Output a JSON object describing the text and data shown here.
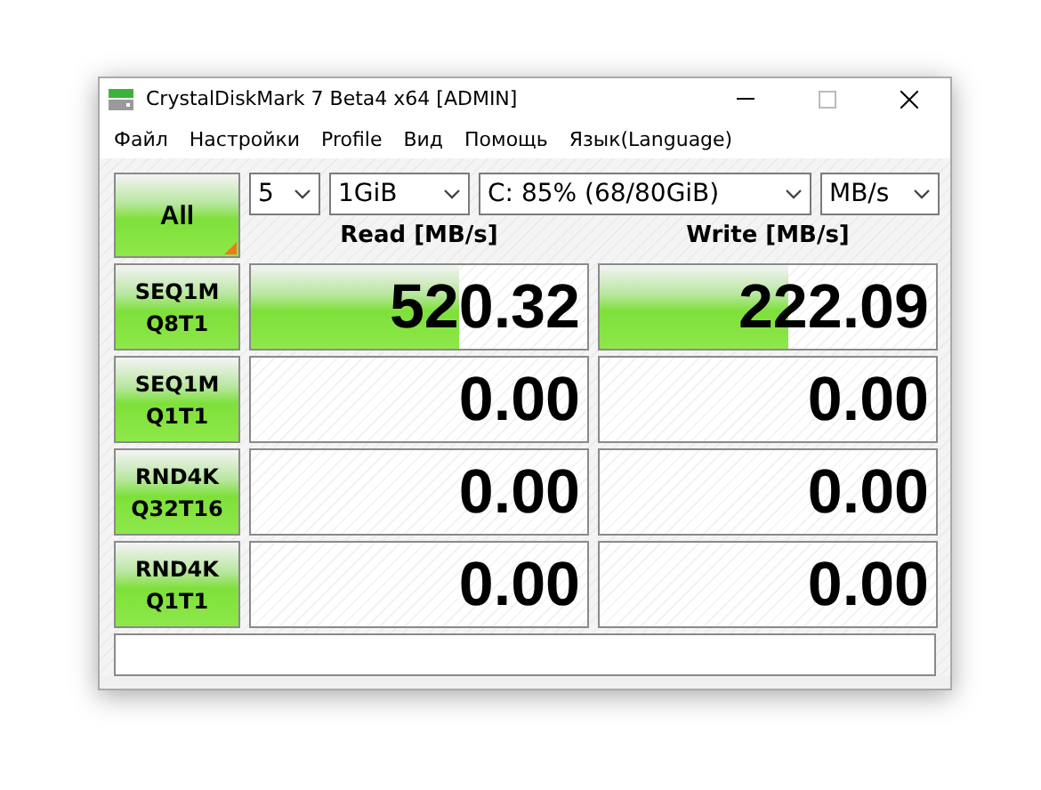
{
  "window": {
    "title": "CrystalDiskMark 7 Beta4 x64 [ADMIN]"
  },
  "menu": [
    "Файл",
    "Настройки",
    "Profile",
    "Вид",
    "Помощь",
    "Язык(Language)"
  ],
  "all_button": {
    "label": "All"
  },
  "dropdowns": [
    {
      "value": "5"
    },
    {
      "value": "1GiB"
    },
    {
      "value": "C: 85% (68/80GiB)"
    },
    {
      "value": "MB/s"
    }
  ],
  "headers": {
    "read": "Read [MB/s]",
    "write": "Write [MB/s]"
  },
  "rows": [
    {
      "name": "SEQ1M",
      "params": "Q8T1",
      "read": {
        "value": "520.32",
        "level": 0.62
      },
      "write": {
        "value": "222.09",
        "level": 0.56
      }
    },
    {
      "name": "SEQ1M",
      "params": "Q1T1",
      "read": {
        "value": "0.00"
      },
      "write": {
        "value": "0.00"
      }
    },
    {
      "name": "RND4K",
      "params": "Q32T16",
      "read": {
        "value": "0.00"
      },
      "write": {
        "value": "0.00"
      }
    },
    {
      "name": "RND4K",
      "params": "Q1T1",
      "read": {
        "value": "0.00"
      },
      "write": {
        "value": "0.00"
      }
    }
  ]
}
